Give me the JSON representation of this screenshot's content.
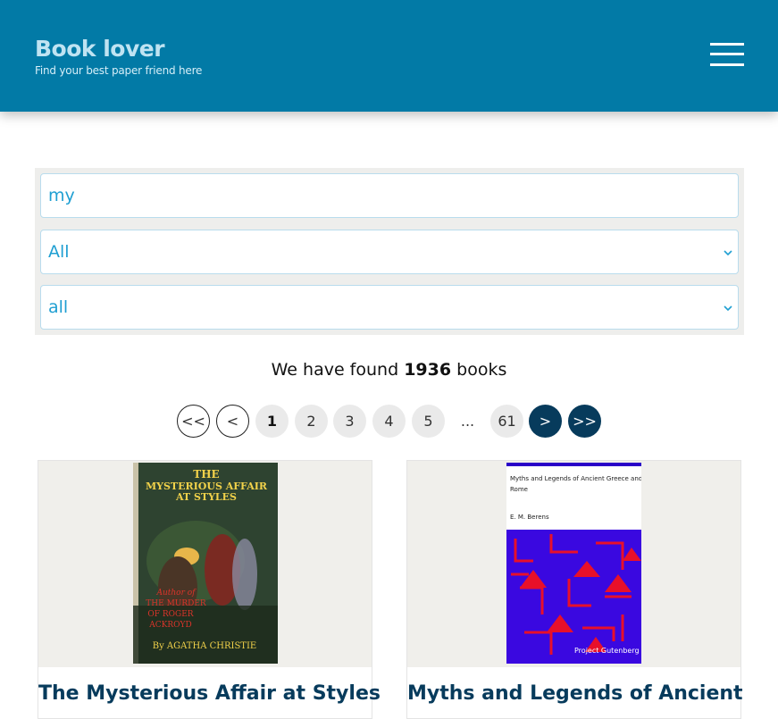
{
  "header": {
    "title": "Book lover",
    "subtitle": "Find your best paper friend here",
    "menu_icon": "hamburger-menu-icon"
  },
  "filters": {
    "search_value": "my",
    "select1_value": "All",
    "select2_value": "all"
  },
  "results": {
    "prefix": "We have found",
    "count": "1936",
    "suffix": "books"
  },
  "pagination": {
    "first": "<<",
    "prev": "<",
    "pages": [
      "1",
      "2",
      "3",
      "4",
      "5"
    ],
    "ellipsis": "...",
    "last_page": "61",
    "next": ">",
    "last": ">>",
    "current": "1"
  },
  "books": [
    {
      "title": "The Mysterious Affair at Styles",
      "cover": {
        "line1": "THE",
        "line2": "MYSTERIOUS AFFAIR",
        "line3": "AT STYLES",
        "author_note": "Author of",
        "author_note2": "THE MURDER",
        "author_note3": "OF ROGER",
        "author_note4": "ACKROYD",
        "author": "By AGATHA CHRISTIE"
      }
    },
    {
      "title": "Myths and Legends of Ancient",
      "cover": {
        "line1": "Myths and Legends of Ancient Greece and",
        "line2": "Rome",
        "author": "E. M. Berens",
        "publisher": "Project Gutenberg"
      }
    }
  ],
  "colors": {
    "header_bg": "#027aa6",
    "accent": "#1f9fd2",
    "dark_btn": "#073b5c"
  }
}
